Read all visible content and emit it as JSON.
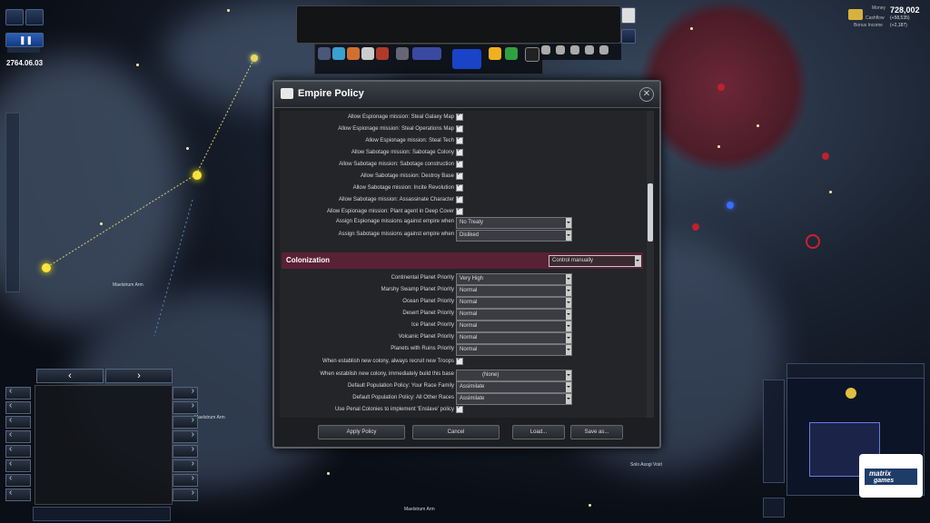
{
  "top_left": {
    "date": "2764.06.03",
    "icons": [
      "globe-icon",
      "gauge-icon"
    ],
    "time_controls": [
      "play-pause-icon"
    ]
  },
  "top_right": {
    "money_label": "Money",
    "money_value": "728,002",
    "cashflow_label": "Cashflow",
    "cashflow_value": "(+58,535)",
    "bonus_label": "Bonus Income",
    "bonus_value": "(+2,187)"
  },
  "map_labels": {
    "maelstrum_arm_1": "Maelstrum Arm",
    "maelstrum_arm_2": "Maelstrum Arm",
    "maelstrum_arm_3": "Maelstrum Arm",
    "solo_asogi_void": "Solo Asogi Void"
  },
  "dialog": {
    "title": "Empire Policy",
    "espionage_rows": [
      {
        "label": "Allow Espionage mission: Steal Galaxy Map",
        "checked": true
      },
      {
        "label": "Allow Espionage mission: Steal Operations Map",
        "checked": true
      },
      {
        "label": "Allow Espionage mission: Steal Tech",
        "checked": true
      },
      {
        "label": "Allow Sabotage mission: Sabotage Colony",
        "checked": true
      },
      {
        "label": "Allow Sabotage mission: Sabotage construction",
        "checked": true
      },
      {
        "label": "Allow Sabotage mission: Destroy Base",
        "checked": true
      },
      {
        "label": "Allow Sabotage mission: Incite Revolution",
        "checked": true
      },
      {
        "label": "Allow Sabotage mission: Assassinate Character",
        "checked": true
      },
      {
        "label": "Allow Espionage mission: Plant agent in Deep Cover",
        "checked": true
      }
    ],
    "assign_espionage_label": "Assign Espionage missions against empire when",
    "assign_espionage_value": "No Treaty",
    "assign_sabotage_label": "Assign Sabotage missions against empire when",
    "assign_sabotage_value": "Disliked",
    "colonization": {
      "header": "Colonization",
      "mode_value": "Control manually",
      "priorities": [
        {
          "label": "Continental Planet Priority",
          "value": "Very High"
        },
        {
          "label": "Marshy Swamp Planet Priority",
          "value": "Normal"
        },
        {
          "label": "Ocean Planet Priority",
          "value": "Normal"
        },
        {
          "label": "Desert Planet Priority",
          "value": "Normal"
        },
        {
          "label": "Ice Planet Priority",
          "value": "Normal"
        },
        {
          "label": "Volcanic Planet Priority",
          "value": "Normal"
        },
        {
          "label": "Planets with Ruins Priority",
          "value": "Normal"
        }
      ],
      "recruit_troops_label": "When establish new colony, always recruit new Troops",
      "build_base_label": "When establish new colony, immediately build this base",
      "build_base_value": "(None)",
      "pop_policy_race_label": "Default Population Policy: Your Race Family",
      "pop_policy_race_value": "Assimilate",
      "pop_policy_other_label": "Default Population Policy: All Other Races",
      "pop_policy_other_value": "Assimilate",
      "penal_label": "Use Penal Colonies to implement 'Enslave' policy"
    },
    "buttons": {
      "apply": "Apply Policy",
      "cancel": "Cancel",
      "load": "Load...",
      "save": "Save as..."
    }
  },
  "colors": {
    "section_header": "#5a2134",
    "dialog_bg": "#1c1e22",
    "money_text": "#ffffff"
  },
  "minimap": {
    "brand_line1": "matrix",
    "brand_line2": "games"
  }
}
